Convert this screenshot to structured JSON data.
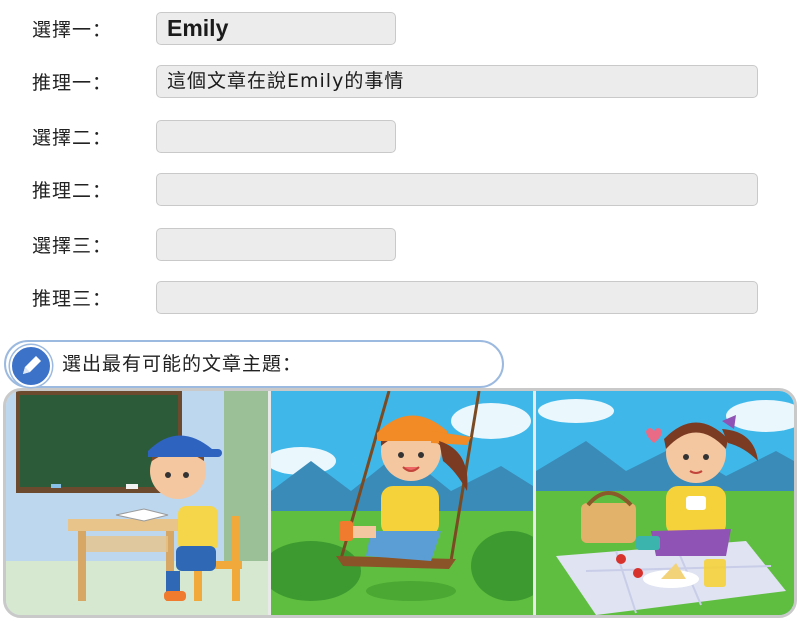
{
  "rows": [
    {
      "label": "選擇一：",
      "value": ""
    },
    {
      "label": "推理一：",
      "value": "這個文章在說Emily的事情"
    },
    {
      "label": "選擇二：",
      "value": ""
    },
    {
      "label": "推理二：",
      "value": ""
    },
    {
      "label": "選擇三：",
      "value": ""
    },
    {
      "label": "推理三：",
      "value": ""
    }
  ],
  "choice1_value": "Emily",
  "prompt": {
    "icon": "pencil-icon",
    "text": "選出最有可能的文章主題："
  },
  "pictures": {
    "panel1": "boy-reading-at-desk",
    "panel2": "girl-on-swing",
    "panel3": "girl-picnic"
  },
  "colors": {
    "field_bg": "#ececec",
    "field_border": "#c9c9c9",
    "accent_blue": "#3d72c9",
    "prompt_border": "#9cb9df"
  }
}
